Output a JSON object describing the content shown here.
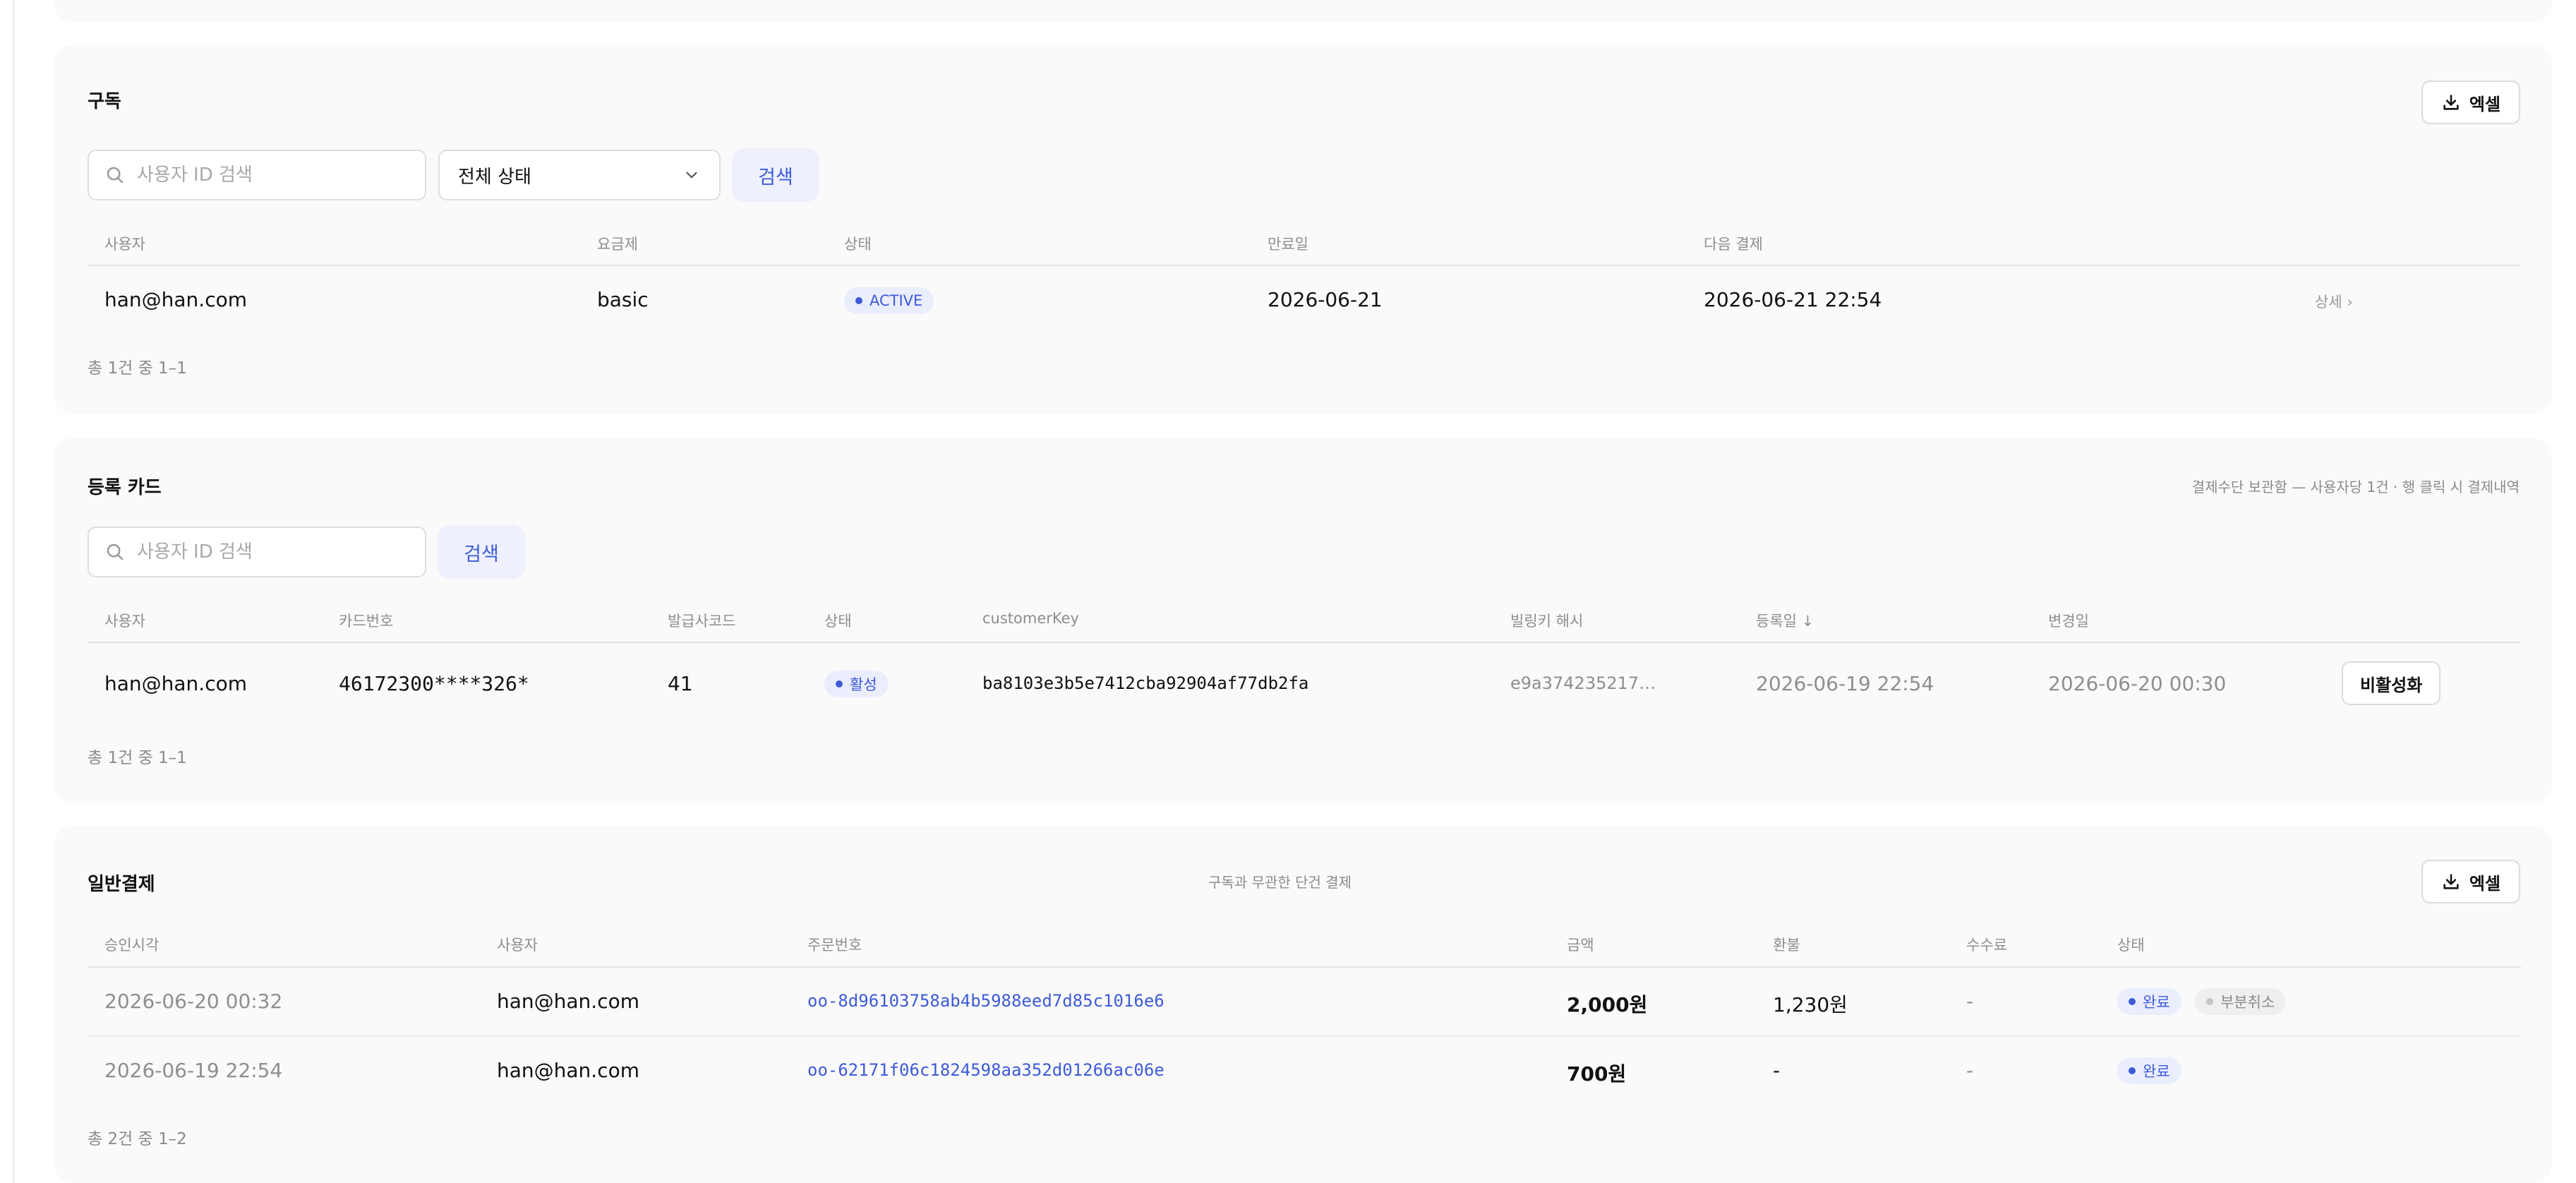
{
  "subscriptions": {
    "title": "구독",
    "excel_label": "엑셀",
    "search_placeholder": "사용자 ID 검색",
    "status_filter": "전체 상태",
    "search_button": "검색",
    "columns": [
      "사용자",
      "요금제",
      "상태",
      "만료일",
      "다음 결제"
    ],
    "rows": [
      {
        "user": "han@han.com",
        "plan": "basic",
        "status": "ACTIVE",
        "expires": "2026-06-21",
        "next_payment": "2026-06-21 22:54",
        "detail": "상세 ›"
      }
    ],
    "footer": "총 1건 중 1–1"
  },
  "cards": {
    "title": "등록 카드",
    "note": "결제수단 보관함 — 사용자당 1건 · 행 클릭 시 결제내역",
    "search_placeholder": "사용자 ID 검색",
    "search_button": "검색",
    "columns": [
      "사용자",
      "카드번호",
      "발급사코드",
      "상태",
      "customerKey",
      "빌링키 해시",
      "등록일",
      "변경일"
    ],
    "sort_indicator": "↓",
    "rows": [
      {
        "user": "han@han.com",
        "card_number": "46172300****326*",
        "issuer_code": "41",
        "status": "활성",
        "customer_key": "ba8103e3b5e7412cba92904af77db2fa",
        "billing_hash": "e9a374235217…",
        "registered": "2026-06-19 22:54",
        "changed": "2026-06-20 00:30",
        "action": "비활성화"
      }
    ],
    "footer": "총 1건 중 1–1"
  },
  "payments": {
    "title": "일반결제",
    "note": "구독과 무관한 단건 결제",
    "excel_label": "엑셀",
    "columns": [
      "승인시각",
      "사용자",
      "주문번호",
      "금액",
      "환불",
      "수수료",
      "상태"
    ],
    "rows": [
      {
        "approved_at": "2026-06-20 00:32",
        "user": "han@han.com",
        "order_id": "oo-8d96103758ab4b5988eed7d85c1016e6",
        "amount": "2,000원",
        "refund": "1,230원",
        "fee": "-",
        "status": "완료",
        "status2": "부분취소"
      },
      {
        "approved_at": "2026-06-19 22:54",
        "user": "han@han.com",
        "order_id": "oo-62171f06c1824598aa352d01266ac06e",
        "amount": "700원",
        "refund": "-",
        "fee": "-",
        "status": "완료"
      }
    ],
    "footer": "총 2건 중 1–2"
  },
  "colors": {
    "accent": "#3d5bd9",
    "card_bg": "#fafafa",
    "pill_bg": "#eaeefc"
  },
  "icons": {
    "search": "search-icon",
    "download": "download-icon",
    "chevron": "chevron-down-icon"
  }
}
